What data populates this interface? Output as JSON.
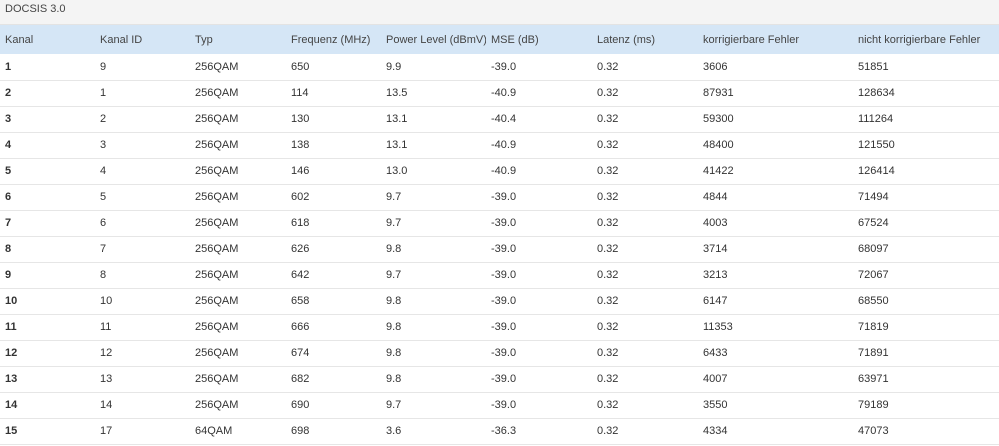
{
  "section": {
    "title": "DOCSIS 3.0"
  },
  "table": {
    "headers": [
      "Kanal",
      "Kanal ID",
      "Typ",
      "Frequenz (MHz)",
      "Power Level (dBmV)",
      "MSE (dB)",
      "Latenz (ms)",
      "korrigierbare Fehler",
      "nicht korrigierbare Fehler"
    ],
    "rows": [
      [
        "1",
        "9",
        "256QAM",
        "650",
        "9.9",
        "-39.0",
        "0.32",
        "3606",
        "51851"
      ],
      [
        "2",
        "1",
        "256QAM",
        "114",
        "13.5",
        "-40.9",
        "0.32",
        "87931",
        "128634"
      ],
      [
        "3",
        "2",
        "256QAM",
        "130",
        "13.1",
        "-40.4",
        "0.32",
        "59300",
        "111264"
      ],
      [
        "4",
        "3",
        "256QAM",
        "138",
        "13.1",
        "-40.9",
        "0.32",
        "48400",
        "121550"
      ],
      [
        "5",
        "4",
        "256QAM",
        "146",
        "13.0",
        "-40.9",
        "0.32",
        "41422",
        "126414"
      ],
      [
        "6",
        "5",
        "256QAM",
        "602",
        "9.7",
        "-39.0",
        "0.32",
        "4844",
        "71494"
      ],
      [
        "7",
        "6",
        "256QAM",
        "618",
        "9.7",
        "-39.0",
        "0.32",
        "4003",
        "67524"
      ],
      [
        "8",
        "7",
        "256QAM",
        "626",
        "9.8",
        "-39.0",
        "0.32",
        "3714",
        "68097"
      ],
      [
        "9",
        "8",
        "256QAM",
        "642",
        "9.7",
        "-39.0",
        "0.32",
        "3213",
        "72067"
      ],
      [
        "10",
        "10",
        "256QAM",
        "658",
        "9.8",
        "-39.0",
        "0.32",
        "6147",
        "68550"
      ],
      [
        "11",
        "11",
        "256QAM",
        "666",
        "9.8",
        "-39.0",
        "0.32",
        "11353",
        "71819"
      ],
      [
        "12",
        "12",
        "256QAM",
        "674",
        "9.8",
        "-39.0",
        "0.32",
        "6433",
        "71891"
      ],
      [
        "13",
        "13",
        "256QAM",
        "682",
        "9.8",
        "-39.0",
        "0.32",
        "4007",
        "63971"
      ],
      [
        "14",
        "14",
        "256QAM",
        "690",
        "9.7",
        "-39.0",
        "0.32",
        "3550",
        "79189"
      ],
      [
        "15",
        "17",
        "64QAM",
        "698",
        "3.6",
        "-36.3",
        "0.32",
        "4334",
        "47073"
      ]
    ]
  }
}
